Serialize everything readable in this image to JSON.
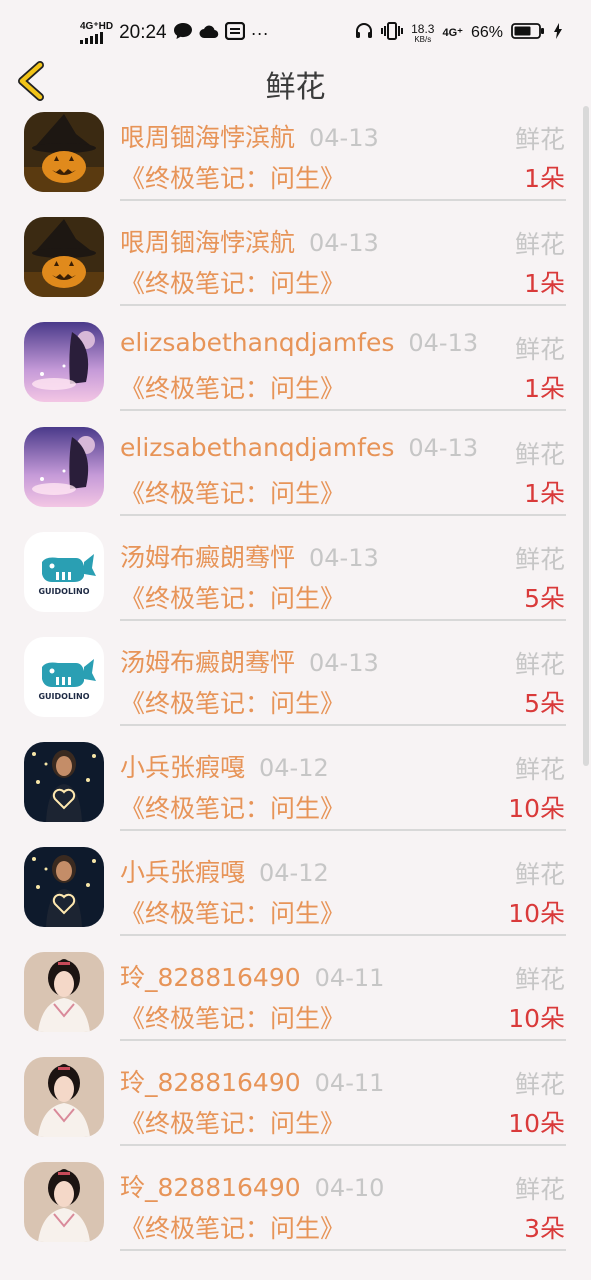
{
  "status_bar": {
    "network_left": "4G⁺HD",
    "time": "20:24",
    "more": "···",
    "speed_value": "18.3",
    "speed_unit": "KB/s",
    "network_right": "4G⁺",
    "battery": "66%",
    "icons": [
      "signal-icon",
      "chat-icon",
      "cloud-icon",
      "message-icon",
      "headphones-icon",
      "vibrate-icon",
      "battery-icon",
      "charging-icon"
    ]
  },
  "header": {
    "title": "鲜花",
    "back_icon": "chevron-left-icon",
    "accent": "#f2c418"
  },
  "colors": {
    "name": "#e79458",
    "date": "#c6c6c6",
    "count": "#d93a3a",
    "background": "#f7f3f4"
  },
  "rows": [
    {
      "avatar": "pumpkin-witch",
      "name": "哏周锢海悖滨航",
      "date": "04-13",
      "book": "《终极笔记：问生》",
      "gift": "鲜花",
      "count": "1朵"
    },
    {
      "avatar": "pumpkin-witch",
      "name": "哏周锢海悖滨航",
      "date": "04-13",
      "book": "《终极笔记：问生》",
      "gift": "鲜花",
      "count": "1朵"
    },
    {
      "avatar": "anime-girl-purple",
      "name": "elizsabethanqdjamfes",
      "date": "04-13",
      "book": "《终极笔记：问生》",
      "gift": "鲜花",
      "count": "1朵"
    },
    {
      "avatar": "anime-girl-purple",
      "name": "elizsabethanqdjamfes",
      "date": "04-13",
      "book": "《终极笔记：问生》",
      "gift": "鲜花",
      "count": "1朵"
    },
    {
      "avatar": "guidolino-logo",
      "name": "汤姆布癜朗骞怦",
      "date": "04-13",
      "book": "《终极笔记：问生》",
      "gift": "鲜花",
      "count": "5朵"
    },
    {
      "avatar": "guidolino-logo",
      "name": "汤姆布癜朗骞怦",
      "date": "04-13",
      "book": "《终极笔记：问生》",
      "gift": "鲜花",
      "count": "5朵"
    },
    {
      "avatar": "girl-heart-lights",
      "name": "小兵张瘕嘎",
      "date": "04-12",
      "book": "《终极笔记：问生》",
      "gift": "鲜花",
      "count": "10朵"
    },
    {
      "avatar": "girl-heart-lights",
      "name": "小兵张瘕嘎",
      "date": "04-12",
      "book": "《终极笔记：问生》",
      "gift": "鲜花",
      "count": "10朵"
    },
    {
      "avatar": "costume-girl",
      "name": "玲_828816490",
      "date": "04-11",
      "book": "《终极笔记：问生》",
      "gift": "鲜花",
      "count": "10朵"
    },
    {
      "avatar": "costume-girl",
      "name": "玲_828816490",
      "date": "04-11",
      "book": "《终极笔记：问生》",
      "gift": "鲜花",
      "count": "10朵"
    },
    {
      "avatar": "costume-girl",
      "name": "玲_828816490",
      "date": "04-10",
      "book": "《终极笔记：问生》",
      "gift": "鲜花",
      "count": "3朵"
    }
  ],
  "guidolino_text": "GUIDOLINO"
}
